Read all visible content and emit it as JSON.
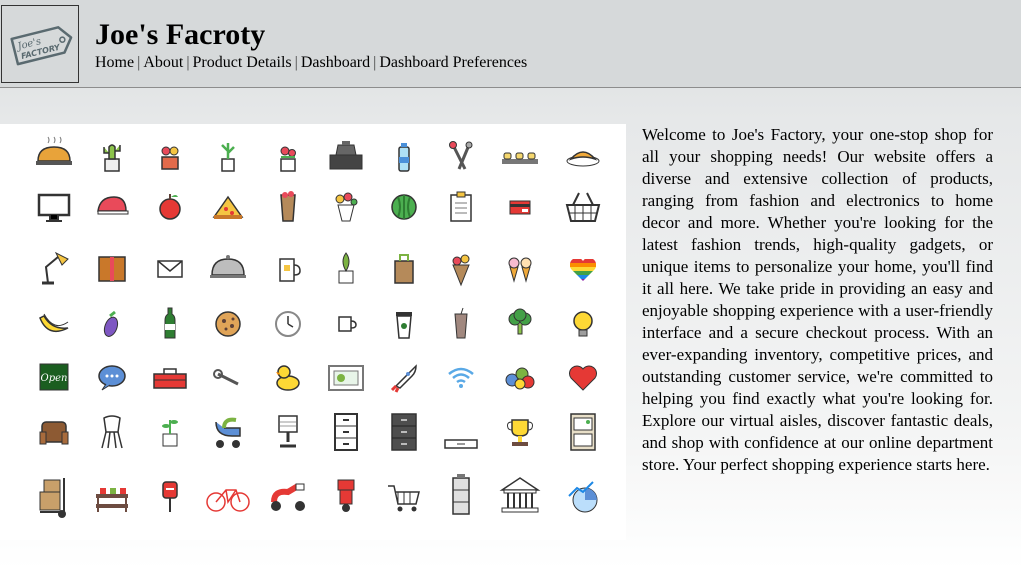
{
  "site": {
    "title": "Joe's Facroty",
    "logo_text": "Joe's FACTORY"
  },
  "nav": {
    "items": [
      {
        "label": "Home"
      },
      {
        "label": "About"
      },
      {
        "label": "Product Details"
      },
      {
        "label": "Dashboard"
      },
      {
        "label": "Dashboard Preferences"
      }
    ],
    "separator": "|"
  },
  "intro_text": "Welcome to Joe's Factory, your one-stop shop for all your shopping needs! Our website offers a diverse and extensive collection of products, ranging from fashion and electronics to home decor and more. Whether you're looking for the latest fashion trends, high-quality gadgets, or unique items to personalize your home, you'll find it all here. We take pride in providing an easy and enjoyable shopping experience with a user-friendly interface and a secure checkout process. With an ever-expanding inventory, competitive prices, and outstanding customer service, we're committed to helping you find exactly what you're looking for. Explore our virtual aisles, discover fantastic deals, and shop with confidence at our online department store. Your perfect shopping experience starts here.",
  "gallery": {
    "rows": [
      [
        "bread-icon",
        "cactus-icon",
        "flower-pot-icon",
        "plant-pot-icon",
        "flowers-icon",
        "cash-register-icon",
        "water-bottle-icon",
        "kitchen-tools-icon",
        "sushi-icon",
        "croissant-icon"
      ],
      [
        "monitor-icon",
        "cap-icon",
        "apple-icon",
        "pizza-slice-icon",
        "wrapped-flowers-icon",
        "bouquet-icon",
        "watermelon-icon",
        "clipboard-icon",
        "credit-card-icon",
        "shopping-basket-icon"
      ],
      [
        "desk-lamp-icon",
        "book-icon",
        "envelope-icon",
        "food-cloche-icon",
        "mug-icon",
        "potted-plant-icon",
        "paper-bag-icon",
        "flower-cone-icon",
        "ice-cream-icon",
        "rainbow-heart-icon"
      ],
      [
        "banana-icon",
        "eggplant-icon",
        "wine-bottle-icon",
        "cookie-icon",
        "wall-clock-icon",
        "cup-icon",
        "coffee-cup-icon",
        "iced-drink-icon",
        "broccoli-icon",
        "light-bulb-icon"
      ],
      [
        "open-sign-icon",
        "chat-bubble-icon",
        "toolbox-icon",
        "wrench-icon",
        "rubber-duck-icon",
        "tablet-icon",
        "rocket-icon",
        "wifi-icon",
        "balloons-icon",
        "heart-icon"
      ],
      [
        "armchair-icon",
        "chair-icon",
        "sprout-icon",
        "stroller-icon",
        "office-chair-icon",
        "filing-cabinet-icon",
        "dresser-icon",
        "drawer-icon",
        "trophy-icon",
        "cabinet-icon"
      ],
      [
        "hand-truck-icon",
        "plant-stand-icon",
        "mailbox-icon",
        "bicycle-icon",
        "scooter-icon",
        "delivery-bike-icon",
        "shopping-cart-icon",
        "server-icon",
        "bank-icon",
        "growth-chart-icon"
      ]
    ]
  },
  "colors": {
    "header_bg": "#d6d9da",
    "text": "#000000"
  }
}
